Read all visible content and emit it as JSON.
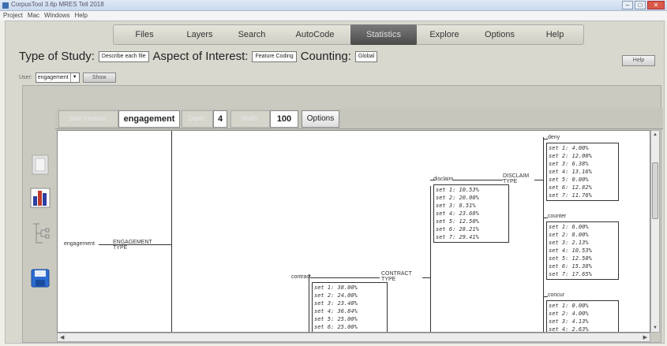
{
  "window": {
    "title": "CorpusTool 3.6p MRES Tell 2018",
    "controls": [
      "–",
      "□",
      "✕"
    ]
  },
  "menu": [
    "Project",
    "Mac",
    "Windows",
    "Help"
  ],
  "tabs": [
    {
      "label": "Files",
      "active": false
    },
    {
      "label": "Layers",
      "active": false
    },
    {
      "label": "Search",
      "active": false
    },
    {
      "label": "AutoCode",
      "active": false
    },
    {
      "label": "Statistics",
      "active": true
    },
    {
      "label": "Explore",
      "active": false
    },
    {
      "label": "Options",
      "active": false
    },
    {
      "label": "Help",
      "active": false
    }
  ],
  "study": {
    "type_label": "Type of Study:",
    "type_value": "Describe each file",
    "aspect_label": "Aspect of Interest:",
    "aspect_value": "Feature Coding",
    "counting_label": "Counting:",
    "counting_value": "Global",
    "help_label": "Help"
  },
  "user": {
    "label": "User:",
    "select_value": "engagement",
    "show_label": "Show"
  },
  "params": {
    "start_label": "Start Feature:",
    "start_value": "engagement",
    "depth_label": "Depth:",
    "depth_value": "4",
    "width_label": "Width:",
    "width_value": "100",
    "options_label": "Options"
  },
  "tree": {
    "root": {
      "label": "engagement",
      "type": "ENGAGEMENT TYPE"
    },
    "contract": {
      "label": "contract",
      "type": "CONTRACT TYPE",
      "rows": [
        "set 1: 38.00%",
        "set 2: 24.00%",
        "set 3: 23.40%",
        "set 4: 36.84%",
        "set 5: 25.00%",
        "set 6: 25.00%"
      ]
    },
    "disclaim": {
      "label": "disclaim",
      "type": "DISCLAIM TYPE",
      "rows": [
        "set 1: 10.53%",
        "set 2: 20.00%",
        "set 3: 8.51%",
        "set 4: 23.68%",
        "set 5: 12.50%",
        "set 6: 28.21%",
        "set 7: 29.41%"
      ]
    },
    "deny": {
      "label": "deny",
      "rows": [
        "set 1: 4.00%",
        "set 2: 12.00%",
        "set 3: 6.38%",
        "set 4: 13.16%",
        "set 5: 0.00%",
        "set 6: 12.82%",
        "set 7: 11.76%"
      ]
    },
    "counter": {
      "label": "counter",
      "rows": [
        "set 1: 6.00%",
        "set 2: 8.00%",
        "set 3: 2.13%",
        "set 4: 10.53%",
        "set 5: 12.50%",
        "set 6: 15.38%",
        "set 7: 17.65%"
      ]
    },
    "concur": {
      "label": "concur",
      "rows": [
        "set 1: 0.00%",
        "set 2: 4.00%",
        "set 3: 4.13%",
        "set 4: 2.63%"
      ]
    }
  },
  "colors": {
    "active_tab": "#5a5a5a",
    "panel": "#cbcac0",
    "chart_icon_blue": "#2c3fa0",
    "chart_icon_red": "#c0392b"
  }
}
